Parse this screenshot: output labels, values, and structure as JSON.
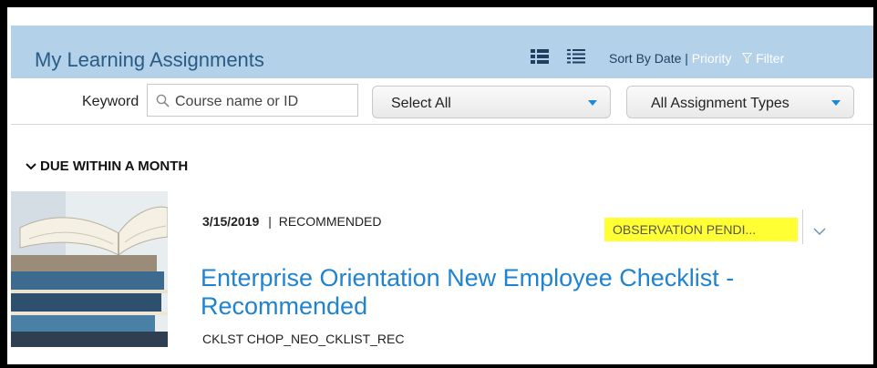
{
  "header": {
    "title": "My Learning Assignments",
    "sort_by_date": "Sort By Date",
    "sort_separator": "|",
    "sort_priority": "Priority",
    "filter_label": "Filter",
    "colors": {
      "header_bg": "#b3d1e8",
      "title": "#2a5a86"
    }
  },
  "filters": {
    "keyword_label": "Keyword",
    "search_placeholder": "Course name or ID",
    "select_all": "Select All",
    "assignment_types": "All Assignment Types"
  },
  "section": {
    "label": "DUE WITHIN A MONTH"
  },
  "item": {
    "date": "3/15/2019",
    "meta_separator": "|",
    "type": "RECOMMENDED",
    "status": "OBSERVATION PENDI...",
    "title": "Enterprise Orientation New Employee Checklist - Recommended",
    "code": "CKLST CHOP_NEO_CKLIST_REC",
    "colors": {
      "title": "#1f83d0",
      "status_highlight": "#ffff33"
    }
  },
  "icons": [
    "list-view-icon",
    "compact-list-view-icon",
    "filter-funnel-icon",
    "search-icon",
    "chevron-down-icon",
    "section-collapse-chevron-icon"
  ]
}
